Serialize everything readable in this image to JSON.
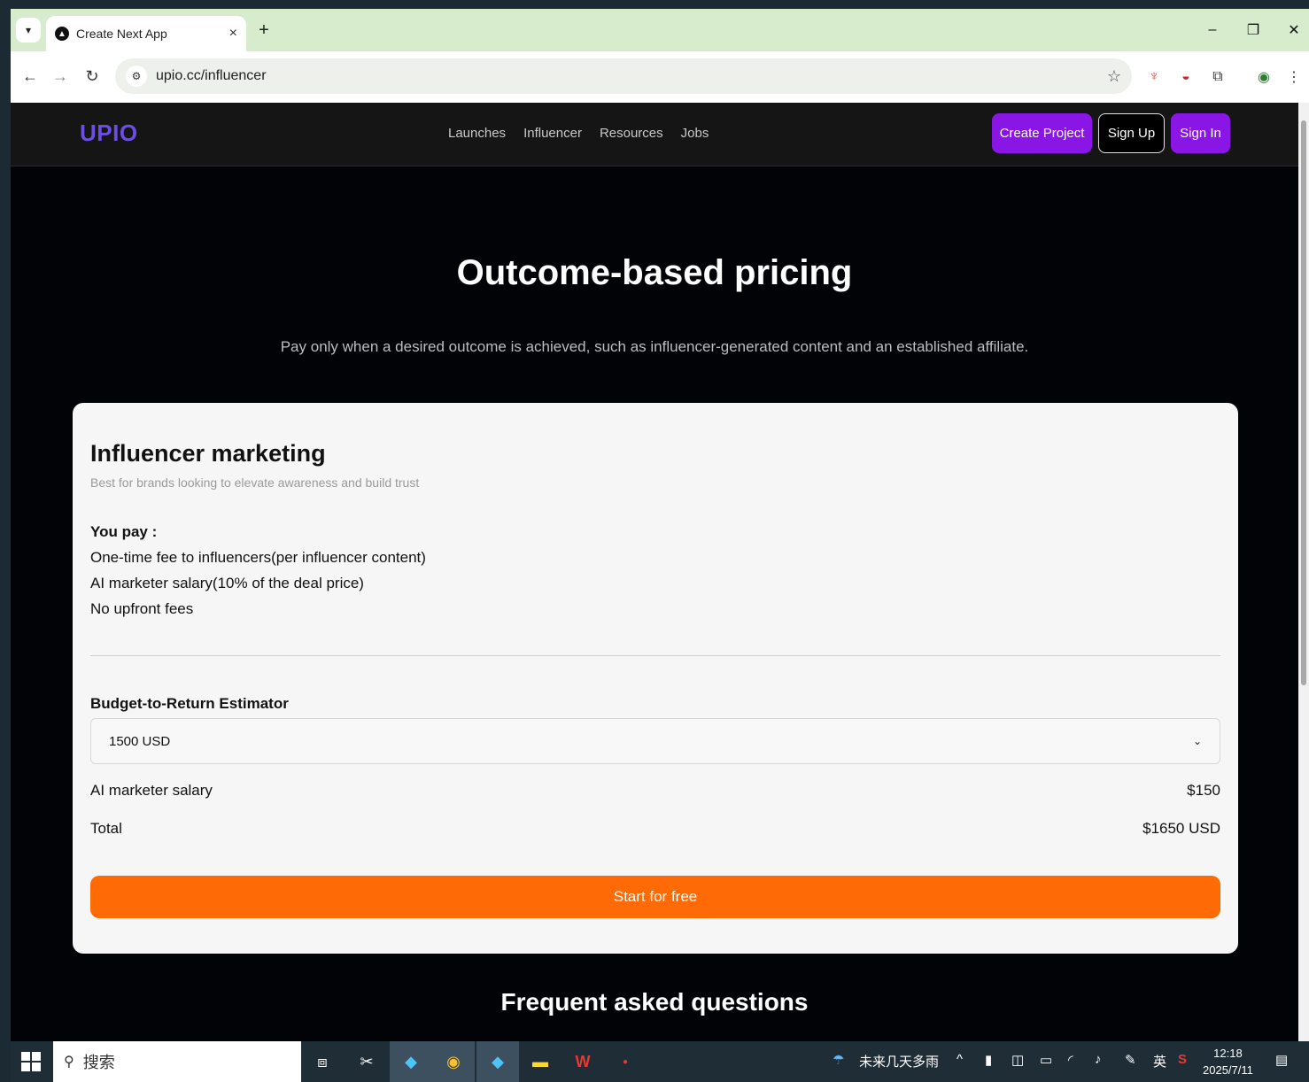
{
  "browser": {
    "tab_title": "Create Next App",
    "url": "upio.cc/influencer",
    "new_tab": "+",
    "close_tab": "×"
  },
  "site": {
    "logo": "UPIO",
    "nav": [
      "Launches",
      "Influencer",
      "Resources",
      "Jobs"
    ],
    "buttons": {
      "create_project": "Create Project",
      "sign_up": "Sign Up",
      "sign_in": "Sign In"
    }
  },
  "hero": {
    "title": "Outcome-based pricing",
    "subtitle": "Pay only when a desired outcome is achieved, such as influencer-generated content and an established affiliate."
  },
  "card": {
    "title": "Influencer marketing",
    "subtitle": "Best for brands looking to elevate awareness and build trust",
    "pay_title": "You pay :",
    "pay_items": [
      "One-time fee to influencers(per influencer content)",
      "AI marketer salary(10% of the deal price)",
      "No upfront fees"
    ],
    "estimator_title": "Budget-to-Return Estimator",
    "budget_selected": "1500 USD",
    "salary_label": "AI marketer salary",
    "salary_value": "$150",
    "total_label": "Total",
    "total_value": "$1650 USD",
    "cta": "Start for free"
  },
  "faq": {
    "title": "Frequent asked questions"
  },
  "taskbar": {
    "search_placeholder": "搜索",
    "weather": "未来几天多雨",
    "ime": "英",
    "time": "12:18",
    "date": "2025/7/11"
  },
  "colors": {
    "accent_purple": "#8a16e6",
    "logo_purple": "#6c4de6",
    "cta_orange": "#fd6a06",
    "chrome_green": "#d6eccd"
  }
}
